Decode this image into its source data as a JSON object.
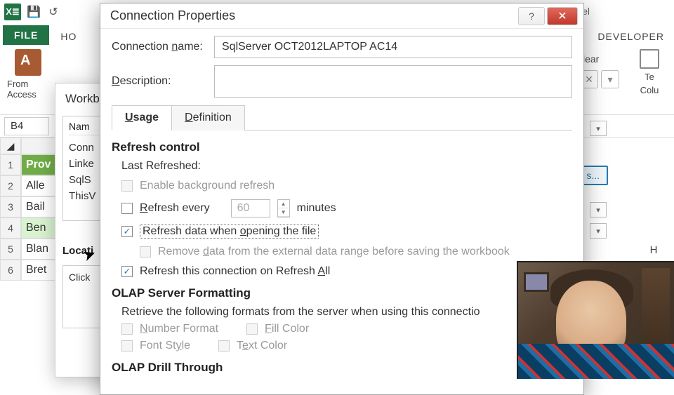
{
  "app": {
    "title_tail": "Pivot - Excel"
  },
  "qat": {
    "save": "💾",
    "undo": "↺"
  },
  "ribbon": {
    "file": "FILE",
    "home_partial": "HO",
    "developer": "DEVELOPER",
    "from_access": "From Access",
    "clear_partial": "lear",
    "text_cols_a": "Te",
    "text_cols_b": "Colu"
  },
  "namebox": "B4",
  "right_col": "H",
  "sheet": {
    "rows": [
      "1",
      "2",
      "3",
      "4",
      "5",
      "6"
    ],
    "hdr": "Prov",
    "cells": [
      "Alle",
      "Bail",
      "Ben",
      "Blan",
      "Bret"
    ]
  },
  "wb": {
    "title": "Workbo",
    "listhdr": "Nam",
    "items": [
      "Conn",
      "Linke",
      "SqlS",
      "ThisV"
    ],
    "loc_label": "Locati",
    "click": "Click"
  },
  "qsel": {
    "text": "s...",
    "arrow": "▾"
  },
  "dlg": {
    "title": "Connection Properties",
    "help": "?",
    "close": "✕",
    "conn_name_lbl_pre": "Connection ",
    "conn_name_lbl_u": "n",
    "conn_name_lbl_post": "ame:",
    "conn_name_val": "SqlServer OCT2012LAPTOP AC14",
    "desc_lbl_u": "D",
    "desc_lbl_post": "escription:",
    "desc_val": "",
    "tab_usage_u": "U",
    "tab_usage_post": "sage",
    "tab_def_u": "D",
    "tab_def_post": "efinition",
    "refresh_control": "Refresh control",
    "last_refreshed": "Last Refreshed:",
    "enable_bg_pre": "Enable back",
    "enable_bg_u": "g",
    "enable_bg_post": "round refresh",
    "refresh_every_u": "R",
    "refresh_every_post": "efresh every",
    "refresh_every_val": "60",
    "minutes": "minutes",
    "refresh_open_pre": "Refresh data when ",
    "refresh_open_u": "o",
    "refresh_open_post": "pening the file",
    "remove_data_pre": "Remove ",
    "remove_data_u": "d",
    "remove_data_post": "ata from the external data range before saving the workbook",
    "refresh_all_pre": "Refresh this connection on Refresh ",
    "refresh_all_u": "A",
    "refresh_all_post": "ll",
    "olap_fmt": "OLAP Server Formatting",
    "olap_fmt_sub": "Retrieve the following formats from the server when using this connectio",
    "num_fmt_u": "N",
    "num_fmt_post": "umber Format",
    "fill_u": "F",
    "fill_post": "ill Color",
    "font_style_pre": "Font St",
    "font_style_u": "y",
    "font_style_post": "le",
    "text_color_pre": "T",
    "text_color_u": "e",
    "text_color_post": "xt Color",
    "olap_drill": "OLAP Drill Through"
  }
}
